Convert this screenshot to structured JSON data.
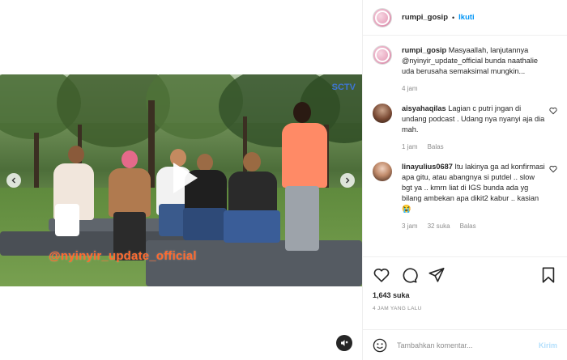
{
  "header": {
    "username": "rumpi_gosip",
    "separator": "•",
    "follow_label": "Ikuti"
  },
  "video": {
    "watermark_text": "@nyinyir_update_official",
    "channel_mark": "SCTV",
    "play_icon": "play-icon",
    "left_arrow_icon": "chevron-left-icon",
    "right_arrow_icon": "chevron-right-icon",
    "sound_icon": "speaker-muted-icon"
  },
  "caption": {
    "username": "rumpi_gosip",
    "text": "Masyaallah, lanjutannya @nyinyir_update_official bunda naathalie uda berusaha semaksimal mungkin...",
    "time": "4 jam"
  },
  "comments": [
    {
      "username": "aisyahaqilas",
      "text": "Lagian c putri jngan di undang podcast . Udang nya nyanyi aja dia mah.",
      "time": "1 jam",
      "likes": "",
      "reply_label": "Balas"
    },
    {
      "username": "linayulius0687",
      "text": "Itu lakinya ga ad konfirmasi apa gitu, atau abangnya si putdel .. slow bgt ya .. kmrn liat di IGS bunda ada yg bilang ambekan apa dikit2 kabur .. kasian 😭",
      "time": "3 jam",
      "likes": "32 suka",
      "reply_label": "Balas"
    }
  ],
  "actions": {
    "like_icon": "heart-icon",
    "comment_icon": "comment-icon",
    "share_icon": "send-icon",
    "save_icon": "bookmark-icon",
    "likes_count": "1,643 suka",
    "posted_ago": "4 JAM YANG LALU"
  },
  "add_comment": {
    "placeholder": "Tambahkan komentar...",
    "send_label": "Kirim",
    "emoji_icon": "smiley-icon"
  },
  "colors": {
    "accent": "#0095f6",
    "watermark": "#ff6a2e",
    "send_disabled": "#b2dffc"
  }
}
